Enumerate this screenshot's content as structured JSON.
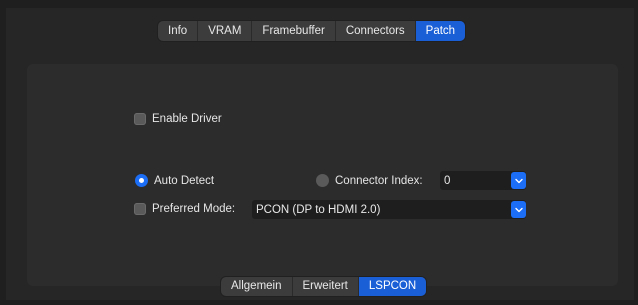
{
  "top_tabs": [
    {
      "label": "Info"
    },
    {
      "label": "VRAM"
    },
    {
      "label": "Framebuffer"
    },
    {
      "label": "Connectors"
    },
    {
      "label": "Patch"
    }
  ],
  "active_top_tab": "Patch",
  "options": {
    "enable_driver_label": "Enable Driver",
    "enable_driver_checked": false,
    "auto_detect_label": "Auto Detect",
    "auto_detect_selected": true,
    "connector_index_label": "Connector Index:",
    "connector_index_selected": false,
    "connector_index_value": "0",
    "preferred_mode_label": "Preferred Mode:",
    "preferred_mode_checked": false,
    "preferred_mode_value": "PCON (DP to HDMI 2.0)"
  },
  "bottom_tabs": [
    {
      "label": "Allgemein"
    },
    {
      "label": "Erweitert"
    },
    {
      "label": "LSPCON"
    }
  ],
  "active_bottom_tab": "LSPCON",
  "icons": {
    "dropdown": "chevron-down-icon"
  },
  "colors": {
    "accent": "#1b6ef5",
    "tab_active": "#1b5fd6"
  }
}
